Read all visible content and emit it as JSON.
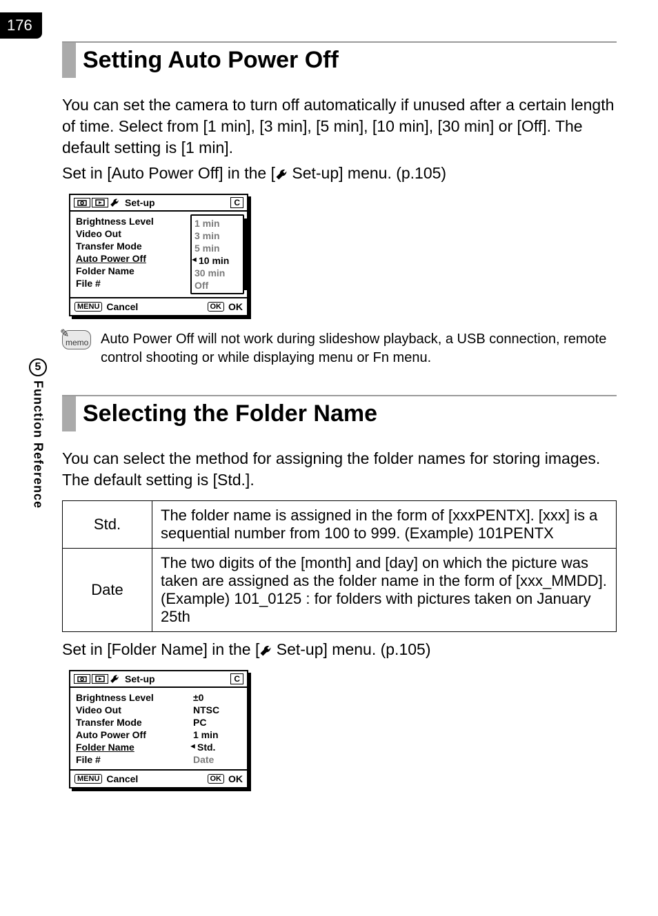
{
  "page_number": "176",
  "side": {
    "chapter": "5",
    "label": "Function Reference"
  },
  "sec1": {
    "heading": "Setting Auto Power Off",
    "para1": "You can set the camera to turn off automatically if unused after a certain length of time. Select from [1 min], [3 min], [5 min], [10 min], [30 min] or [Off]. The default setting is [1 min].",
    "para2a": "Set in [Auto Power Off] in the [",
    "para2b": " Set-up] menu. (p.105)",
    "memo_label": "memo",
    "memo_text": "Auto Power Off will not work during slideshow playback, a USB connection, remote control shooting or while displaying menu or Fn menu."
  },
  "lcd1": {
    "tab_title": "Set-up",
    "tab_c": "C",
    "items": [
      "Brightness Level",
      "Video Out",
      "Transfer Mode",
      "Auto Power Off",
      "Folder Name",
      "File #"
    ],
    "values": [
      "1 min",
      "3 min",
      "5 min",
      "10 min",
      "30 min",
      "Off"
    ],
    "selected_index": 3,
    "footer_menu_key": "MENU",
    "footer_cancel": "Cancel",
    "footer_ok_key": "OK",
    "footer_ok": "OK"
  },
  "sec2": {
    "heading": "Selecting the Folder Name",
    "para1": "You can select the method for assigning the folder names for storing images. The default setting is [Std.].",
    "table": {
      "rows": [
        {
          "key": "Std.",
          "desc": "The folder name is assigned in the form of [xxxPENTX]. [xxx] is a sequential number from 100 to 999.\n(Example) 101PENTX"
        },
        {
          "key": "Date",
          "desc": "The two digits of the [month] and [day] on which the picture was taken are assigned as the folder name in the form of [xxx_MMDD].\n(Example) 101_0125 : for folders with pictures taken on January 25th"
        }
      ]
    },
    "para2a": "Set in [Folder Name] in the [",
    "para2b": " Set-up] menu. (p.105)"
  },
  "lcd2": {
    "tab_title": "Set-up",
    "tab_c": "C",
    "items": [
      "Brightness Level",
      "Video Out",
      "Transfer Mode",
      "Auto Power Off",
      "Folder Name",
      "File #"
    ],
    "values": [
      "±0",
      "NTSC",
      "PC",
      "1 min",
      "Std.",
      "Date"
    ],
    "selected_index": 4,
    "footer_menu_key": "MENU",
    "footer_cancel": "Cancel",
    "footer_ok_key": "OK",
    "footer_ok": "OK"
  }
}
